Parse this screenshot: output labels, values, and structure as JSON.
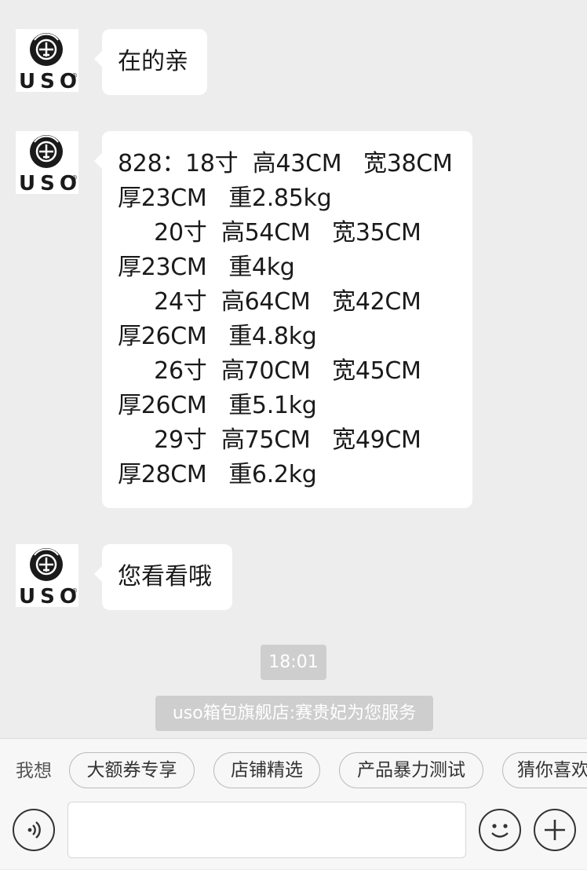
{
  "brand": {
    "avatar_text": "USO",
    "registered_mark": "®"
  },
  "messages": [
    {
      "text": "在的亲"
    },
    {
      "text": "828：18寸  高43CM   宽38CM\n厚23CM   重2.85kg\n     20寸  高54CM   宽35CM\n厚23CM   重4kg\n     24寸  高64CM   宽42CM\n厚26CM   重4.8kg\n     26寸  高70CM   宽45CM\n厚26CM   重5.1kg\n     29寸  高75CM   宽49CM\n厚28CM   重6.2kg"
    },
    {
      "text": "您看看哦"
    }
  ],
  "timestamp": "18:01",
  "system_notice": "uso箱包旗舰店:赛贵妃为您服务",
  "quick_replies": {
    "label": "我想",
    "items": [
      "大额券专享",
      "店铺精选",
      "产品暴力测试",
      "猜你喜欢"
    ]
  },
  "input": {
    "value": "",
    "placeholder": ""
  },
  "icons": {
    "voice": "voice-icon",
    "emoji": "emoji-icon",
    "plus": "plus-icon"
  },
  "colors": {
    "background": "#ededed",
    "bubble": "#ffffff",
    "badge": "#cecece",
    "panel": "#f7f7f7"
  }
}
